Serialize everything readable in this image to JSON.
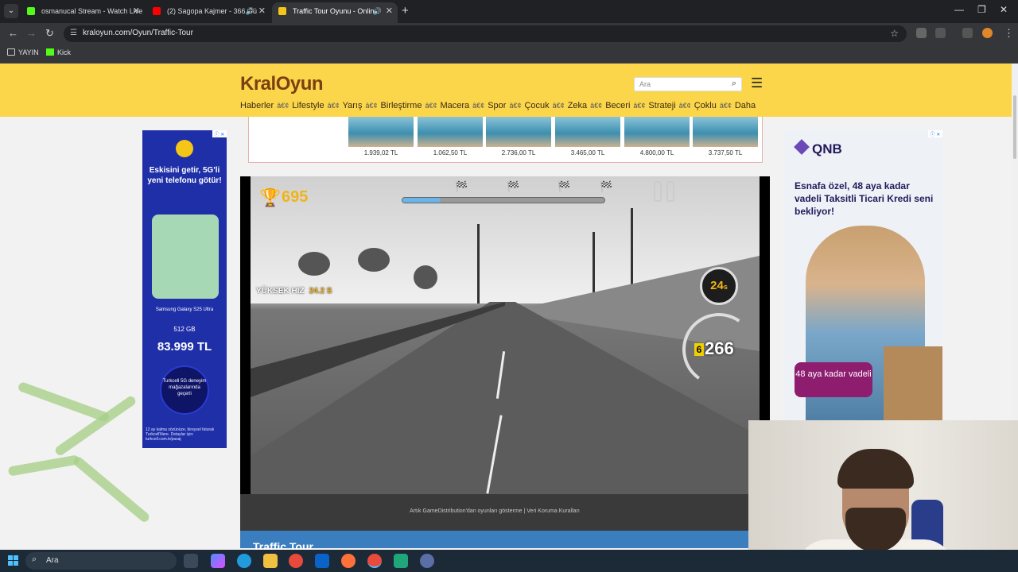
{
  "browser": {
    "tabs": [
      {
        "title": "osmanucal Stream - Watch Live",
        "favicon_color": "#53fc18"
      },
      {
        "title": "(2) Sagopa Kajmer - 366.Gü",
        "favicon_color": "#ff0000"
      },
      {
        "title": "Traffic Tour Oyunu - Online",
        "favicon_color": "#f5c518"
      }
    ],
    "url": "kraloyun.com/Oyun/Traffic-Tour",
    "bookmarks": [
      {
        "label": "YAYIN",
        "icon": "folder-icon"
      },
      {
        "label": "Kick",
        "icon": "kick-icon"
      }
    ]
  },
  "site": {
    "logo": "KralOyun",
    "search_placeholder": "Ara",
    "nav": [
      "Haberler",
      "Lifestyle",
      "Yarış",
      "Birleştirme",
      "Macera",
      "Spor",
      "Çocuk",
      "Zeka",
      "Beceri",
      "Strateji",
      "Çoklu",
      "Daha"
    ],
    "nav_separator": "â€¢"
  },
  "ad_strip": {
    "prices": [
      "1.939,02 TL",
      "1.062,50 TL",
      "2.736,00 TL",
      "3.465,00 TL",
      "4.800,00 TL",
      "3.737,50 TL"
    ]
  },
  "left_ad": {
    "headline": "Eskisini getir, 5G'li yeni telefonu götür!",
    "model": "Samsung Galaxy S25 Ultra",
    "storage": "512 GB",
    "price": "83.999 TL",
    "badge": "Turkcell 5G deneyim mağazalarında geçerli",
    "fine_print": "12 ay kalma sözünüze, bireysel faturalı Turkcell'lilere. Detaylar için: turkcell.com.tr/pasaj"
  },
  "game": {
    "score": "695",
    "progress": 0.19,
    "speed_label": "YÜKSEK HIZ",
    "speed_time": "24.2 S",
    "timer": "24",
    "timer_unit": "s",
    "gear": "6",
    "speed": "266",
    "footer": "Artık GameDistribution'dan oyunları gösterme | Veri Koruma Kuralları",
    "title": "Traffic Tour"
  },
  "right_ad": {
    "brand": "QNB",
    "text": "Esnafa özel, 48 aya kadar vadeli Taksitli Ticari Kredi seni bekliyor!",
    "badge": "48 aya kadar vadeli"
  },
  "taskbar": {
    "search_placeholder": "Ara"
  }
}
